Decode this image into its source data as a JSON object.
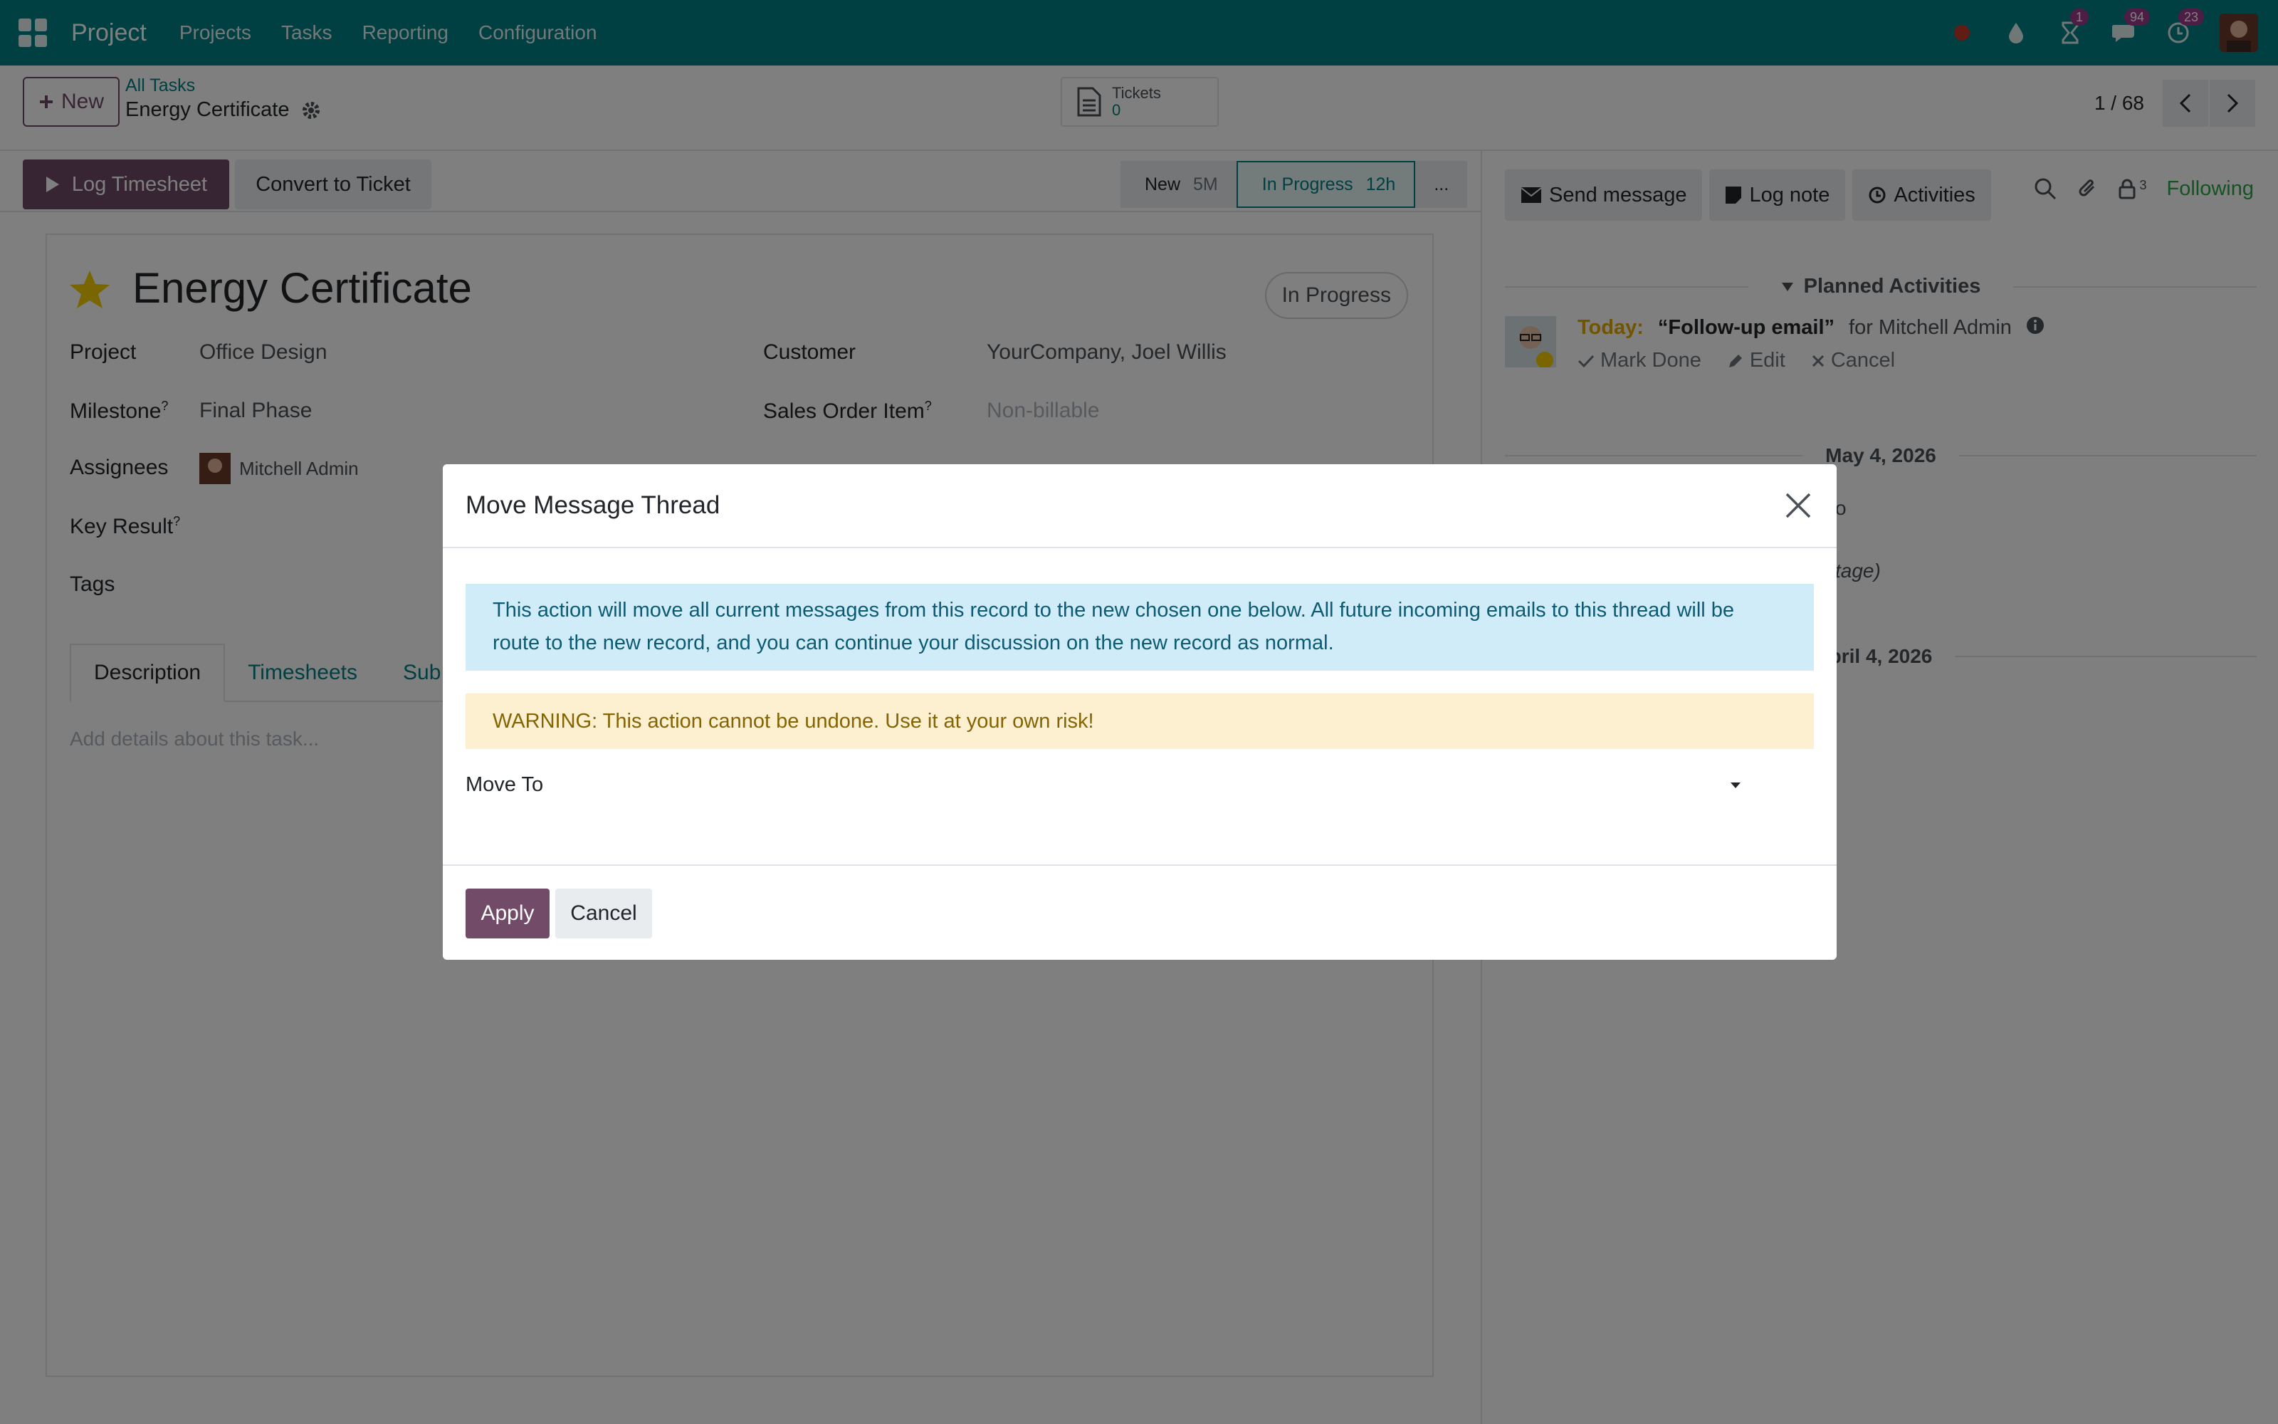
{
  "navbar": {
    "brand": "Project",
    "menu": [
      "Projects",
      "Tasks",
      "Reporting",
      "Configuration"
    ],
    "badges": {
      "activities": "1",
      "messages": "94",
      "updates": "23"
    },
    "color": "#017e84"
  },
  "control_panel": {
    "new_label": "New",
    "breadcrumb_parent": "All Tasks",
    "breadcrumb_current": "Energy Certificate",
    "smart_button": {
      "label": "Tickets",
      "value": "0"
    },
    "pager": "1 / 68"
  },
  "statusbar": {
    "log_timesheet": "Log Timesheet",
    "convert_to_ticket": "Convert to Ticket",
    "stages": [
      {
        "label": "New",
        "duration": "5M"
      },
      {
        "label": "In Progress",
        "duration": "12h"
      }
    ],
    "more": "..."
  },
  "form": {
    "title": "Energy Certificate",
    "status": "In Progress",
    "labels": {
      "project": "Project",
      "milestone": "Milestone",
      "assignees": "Assignees",
      "key_result": "Key Result",
      "tags": "Tags",
      "customer": "Customer",
      "sales_order_item": "Sales Order Item",
      "help_mark": "?"
    },
    "values": {
      "project": "Office Design",
      "milestone": "Final Phase",
      "assignee": "Mitchell Admin",
      "customer": "YourCompany, Joel Willis",
      "sales_order_item_placeholder": "Non-billable"
    },
    "tabs": [
      "Description",
      "Timesheets",
      "Sub"
    ],
    "description_placeholder": "Add details about this task..."
  },
  "chatter": {
    "send_message": "Send message",
    "log_note": "Log note",
    "activities": "Activities",
    "followers_count": "3",
    "following": "Following",
    "planned_activities": "Planned Activities",
    "activity": {
      "today": "Today:",
      "name": "“Follow-up email”",
      "for": "for Mitchell Admin",
      "mark_done": "Mark Done",
      "edit": "Edit",
      "cancel": "Cancel"
    },
    "date_1": "May 4, 2026",
    "fragment_1": "o",
    "fragment_2": "tage)",
    "date_2": "pril 4, 2026"
  },
  "modal": {
    "title": "Move Message Thread",
    "info": "This action will move all current messages from this record to the new chosen one below. All future incoming emails to this thread will be route to the new record, and you can continue your discussion on the new record as normal.",
    "warning": "WARNING: This action cannot be undone. Use it at your own risk!",
    "move_to_label": "Move To",
    "apply": "Apply",
    "cancel": "Cancel"
  }
}
